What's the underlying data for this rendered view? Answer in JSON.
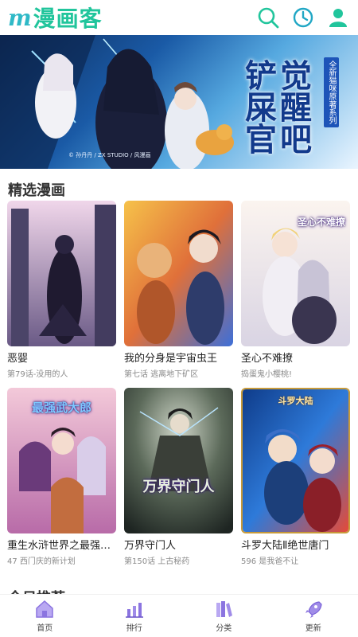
{
  "header": {
    "logo_m": "m",
    "logo_text": "漫画客",
    "icons": [
      "search-icon",
      "history-clock-icon",
      "user-icon"
    ],
    "accent_color": "#21c59c"
  },
  "banner": {
    "title": "觉醒吧 铲屎官",
    "subtitle": "全新猫咪原著系列",
    "credit": "© 孙丹丹 / ZX STUDIO / 风漫画"
  },
  "featured": {
    "section_title": "精选漫画",
    "items": [
      {
        "title": "恶婴",
        "subtitle": "第79话-没用的人",
        "cover_label": ""
      },
      {
        "title": "我的分身是宇宙虫王",
        "subtitle": "第七话 逃离地下矿区",
        "cover_label": ""
      },
      {
        "title": "圣心不难撩",
        "subtitle": "捣蛋鬼小樱桃!",
        "cover_label": "圣心不难撩"
      },
      {
        "title": "重生水浒世界之最强武大郎",
        "subtitle": "47 西门庆的新计划",
        "cover_label": "最强武大郎"
      },
      {
        "title": "万界守门人",
        "subtitle": "第150话 上古秘药",
        "cover_label": "万界守门人"
      },
      {
        "title": "斗罗大陆Ⅱ绝世唐门",
        "subtitle": "596 是我爸不让",
        "cover_label": "斗罗大陆"
      }
    ]
  },
  "next_section_title": "今日推荐",
  "bottom_nav": [
    {
      "label": "首页",
      "icon": "home-icon"
    },
    {
      "label": "排行",
      "icon": "ranking-icon"
    },
    {
      "label": "分类",
      "icon": "category-icon"
    },
    {
      "label": "更新",
      "icon": "rocket-icon"
    }
  ]
}
